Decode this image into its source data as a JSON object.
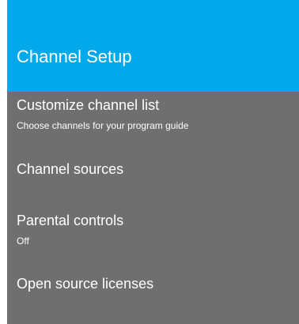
{
  "header": {
    "title": "Channel Setup"
  },
  "menu": {
    "items": [
      {
        "title": "Customize channel list",
        "subtitle": "Choose channels for your program guide"
      },
      {
        "title": "Channel sources",
        "subtitle": ""
      },
      {
        "title": "Parental controls",
        "subtitle": "Off"
      },
      {
        "title": "Open source licenses",
        "subtitle": ""
      }
    ]
  },
  "colors": {
    "header_bg": "#00a9ea",
    "panel_bg": "#6f6f6f",
    "text": "#ffffff"
  }
}
